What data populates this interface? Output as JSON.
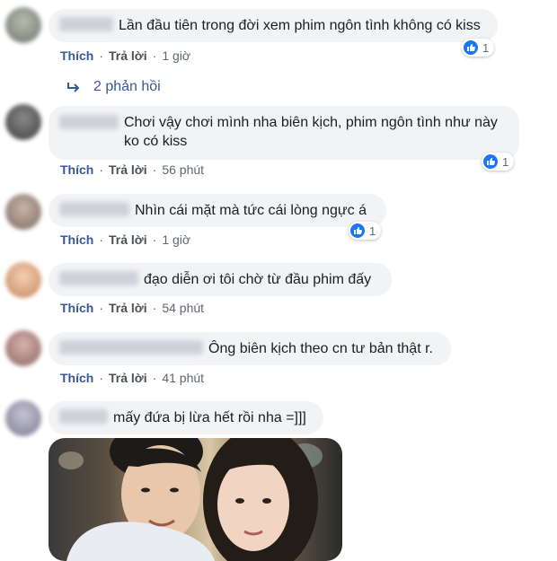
{
  "comments": [
    {
      "text": "Lần đầu tiên trong đời xem phim ngôn tình không có kiss",
      "like": "Thích",
      "reply": "Trả lời",
      "time": "1 giờ",
      "reactions": "1"
    },
    {
      "text": "Chơi vậy chơi mình nha biên kịch, phim ngôn tình như này ko có kiss",
      "like": "Thích",
      "reply": "Trả lời",
      "time": "56 phút",
      "reactions": "1"
    },
    {
      "text": "Nhìn cái mặt mà tức cái lòng ngực á",
      "like": "Thích",
      "reply": "Trả lời",
      "time": "1 giờ",
      "reactions": "1"
    },
    {
      "text": "đạo diễn ơi tôi chờ từ đầu phim đấy",
      "like": "Thích",
      "reply": "Trả lời",
      "time": "54 phút"
    },
    {
      "text": "Ông biên kịch theo cn tư bản thật r.",
      "like": "Thích",
      "reply": "Trả lời",
      "time": "41 phút"
    },
    {
      "text": "mấy đứa bị lừa hết rồi nha =]]]"
    }
  ],
  "replies_link": "2 phản hồi",
  "dot": "·",
  "colors": {
    "link_blue": "#385898",
    "like_blue": "#1877f2",
    "bubble_bg": "#f2f3f5"
  }
}
